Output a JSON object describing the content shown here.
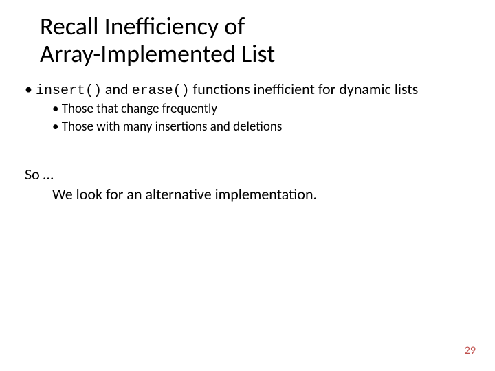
{
  "title_line1": "Recall Inefficiency of",
  "title_line2": "Array-Implemented List",
  "bullet1": {
    "code1": "insert()",
    "mid": " and ",
    "code2": "erase()",
    "tail": " functions inefficient for dynamic lists"
  },
  "sub1": "Those that change frequently",
  "sub2": "Those with many insertions and deletions",
  "so_line1": "So  …",
  "so_line2": "We look for an alternative implementation.",
  "page_number": "29"
}
